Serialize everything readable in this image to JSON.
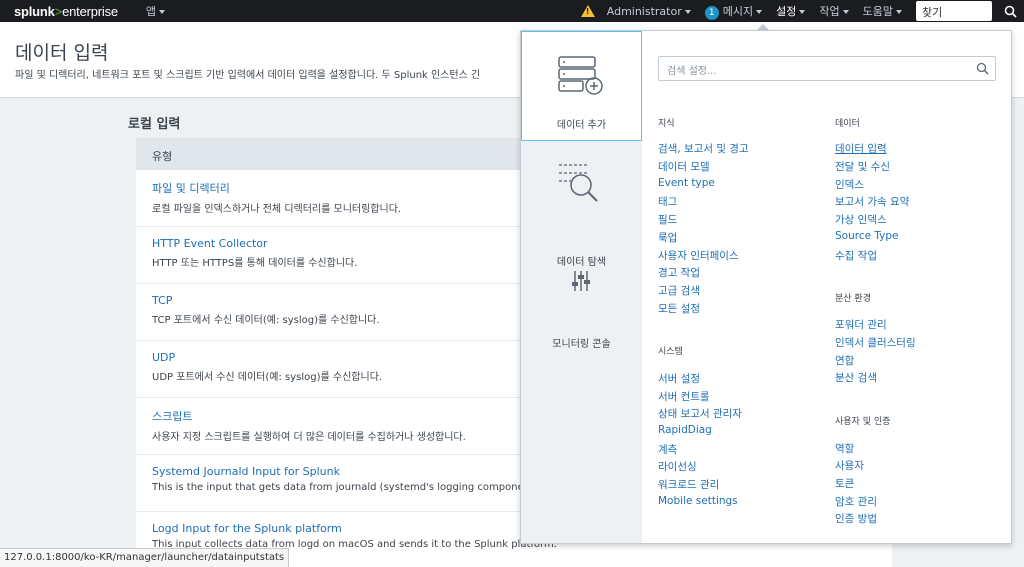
{
  "topbar": {
    "logo_main": "splunk",
    "logo_gt": ">",
    "logo_ent": "enterprise",
    "app": "앱",
    "admin": "Administrator",
    "msg_count": "1",
    "messages": "메시지",
    "settings": "설정",
    "jobs": "작업",
    "help": "도움말",
    "find": "찾기"
  },
  "page": {
    "title": "데이터 입력",
    "description": "파일 및 디렉터리, 네트워크 포트 및 스크립트 기반 입력에서 데이터 입력을 설정합니다. 두 Splunk 인스턴스 긴",
    "section": "로컬 입력",
    "table_header": "유형",
    "rows": [
      {
        "title": "파일 및 디렉터리",
        "desc": "로컬 파일을 인덱스하거나 전체 디렉터리를 모니터링합니다."
      },
      {
        "title": "HTTP Event Collector",
        "desc": "HTTP 또는 HTTPS를 통해 데이터를 수신합니다."
      },
      {
        "title": "TCP",
        "desc": "TCP 포트에서 수신 데이터(예: syslog)를 수신합니다."
      },
      {
        "title": "UDP",
        "desc": "UDP 포트에서 수신 데이터(예: syslog)를 수신합니다."
      },
      {
        "title": "스크립트",
        "desc": "사용자 지정 스크립트를 실행하여 더 많은 데이터를 수집하거나 생성합니다."
      },
      {
        "title": "Systemd Journald Input for Splunk",
        "desc": "This is the input that gets data from journald (systemd's logging component"
      },
      {
        "title": "Logd Input for the Splunk platform",
        "desc": "This input collects data from logd on macOS and sends it to the Splunk platform."
      }
    ]
  },
  "statusbar": "127.0.0.1:8000/ko-KR/manager/launcher/datainputstats",
  "menu": {
    "left": [
      "데이터 추가",
      "데이터 탐색",
      "모니터링 콘솔"
    ],
    "search_placeholder": "검색 설정...",
    "knowledge": {
      "title": "지식",
      "items": [
        "검색, 보고서 및 경고",
        "데이터 모델",
        "Event type",
        "태그",
        "필드",
        "룩업",
        "사용자 인터페이스",
        "경고 작업",
        "고급 검색",
        "모든 설정"
      ]
    },
    "system": {
      "title": "시스템",
      "items": [
        "서버 설정",
        "서버 컨트롤",
        "상태 보고서 관리자",
        "RapidDiag",
        "계측",
        "라이선싱",
        "워크로드 관리",
        "Mobile settings"
      ]
    },
    "data": {
      "title": "데이터",
      "items": [
        "데이터 입력",
        "전달 및 수신",
        "인덱스",
        "보고서 가속 요약",
        "가상 인덱스",
        "Source Type",
        "수집 작업"
      ]
    },
    "distributed": {
      "title": "분산 환경",
      "items": [
        "포워더 관리",
        "인덱서 클러스터링",
        "연합",
        "분산 검색"
      ]
    },
    "users": {
      "title": "사용자 및 인증",
      "items": [
        "역할",
        "사용자",
        "토큰",
        "암호 관리",
        "인증 방법"
      ]
    }
  }
}
